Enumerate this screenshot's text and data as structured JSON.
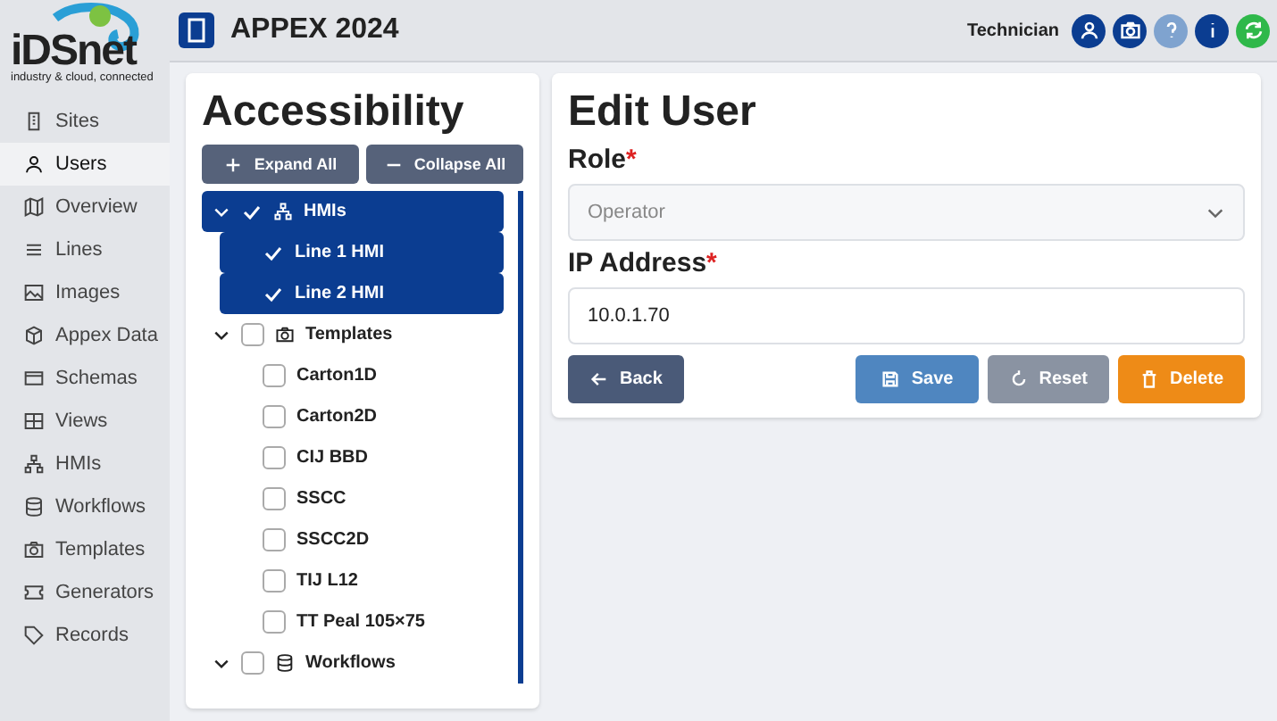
{
  "logo": {
    "name": "iDSnet",
    "tagline": "industry & cloud, connected"
  },
  "sidebar": {
    "items": [
      {
        "label": "Sites",
        "kind": "building",
        "selected": false
      },
      {
        "label": "Users",
        "kind": "user",
        "selected": true
      },
      {
        "label": "Overview",
        "kind": "map",
        "selected": false
      },
      {
        "label": "Lines",
        "kind": "lines",
        "selected": false
      },
      {
        "label": "Images",
        "kind": "image",
        "selected": false
      },
      {
        "label": "Appex Data",
        "kind": "cube",
        "selected": false
      },
      {
        "label": "Schemas",
        "kind": "card",
        "selected": false
      },
      {
        "label": "Views",
        "kind": "grid",
        "selected": false
      },
      {
        "label": "HMIs",
        "kind": "network",
        "selected": false
      },
      {
        "label": "Workflows",
        "kind": "database",
        "selected": false
      },
      {
        "label": "Templates",
        "kind": "camera",
        "selected": false
      },
      {
        "label": "Generators",
        "kind": "ticket",
        "selected": false
      },
      {
        "label": "Records",
        "kind": "tag",
        "selected": false
      }
    ]
  },
  "header": {
    "title": "APPEX 2024",
    "role": "Technician",
    "actions": [
      {
        "kind": "user",
        "color": "#0b3d91"
      },
      {
        "kind": "camera",
        "color": "#0b3d91"
      },
      {
        "kind": "help",
        "color": "#7fa3cf"
      },
      {
        "kind": "info",
        "color": "#0b3d91"
      },
      {
        "kind": "refresh",
        "color": "#2fb84a"
      }
    ]
  },
  "accessibility": {
    "title": "Accessibility",
    "buttons": [
      {
        "label": "Expand All",
        "kind": "plus"
      },
      {
        "label": "Collapse All",
        "kind": "minus"
      }
    ],
    "tree": [
      {
        "label": "HMIs",
        "kind": "network",
        "checked": true,
        "selected": true,
        "expanded": true,
        "children": [
          {
            "label": "Line 1 HMI",
            "checked": true,
            "selected": true
          },
          {
            "label": "Line 2 HMI",
            "checked": true,
            "selected": true
          }
        ]
      },
      {
        "label": "Templates",
        "kind": "camera",
        "checked": false,
        "selected": false,
        "expanded": true,
        "children": [
          {
            "label": "Carton1D",
            "checked": false,
            "selected": false
          },
          {
            "label": "Carton2D",
            "checked": false,
            "selected": false
          },
          {
            "label": "CIJ BBD",
            "checked": false,
            "selected": false
          },
          {
            "label": "SSCC",
            "checked": false,
            "selected": false
          },
          {
            "label": "SSCC2D",
            "checked": false,
            "selected": false
          },
          {
            "label": "TIJ L12",
            "checked": false,
            "selected": false
          },
          {
            "label": "TT Peal 105×75",
            "checked": false,
            "selected": false
          }
        ]
      },
      {
        "label": "Workflows",
        "kind": "database",
        "checked": false,
        "selected": false,
        "expanded": true
      }
    ]
  },
  "edit_user": {
    "title": "Edit User",
    "fields": [
      {
        "label": "Role",
        "required_mark": "*",
        "kind": "select",
        "placeholder": "Operator"
      },
      {
        "label": "IP Address",
        "required_mark": "*",
        "kind": "text",
        "value": "10.0.1.70"
      }
    ],
    "buttons": [
      {
        "label": "Back",
        "kind": "arrow",
        "color": "#4a5a78"
      },
      {
        "label": "Save",
        "kind": "save",
        "color": "#4f86c0"
      },
      {
        "label": "Reset",
        "kind": "reset",
        "color": "#8a93a2"
      },
      {
        "label": "Delete",
        "kind": "trash",
        "color": "#ee8b17"
      }
    ]
  }
}
